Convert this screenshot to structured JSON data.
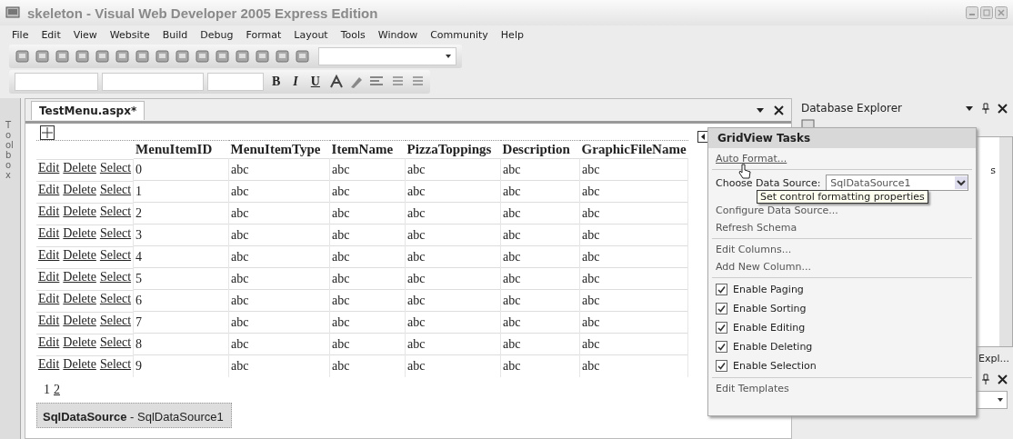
{
  "window": {
    "title": "skeleton - Visual Web Developer 2005 Express Edition"
  },
  "menu": [
    "File",
    "Edit",
    "View",
    "Website",
    "Build",
    "Debug",
    "Format",
    "Layout",
    "Tools",
    "Window",
    "Community",
    "Help"
  ],
  "format_toolbar": {
    "buttons": [
      "B",
      "I",
      "U"
    ]
  },
  "toolbox": {
    "label": "Toolbox"
  },
  "document": {
    "tab": {
      "label": "TestMenu.aspx*",
      "selected": true
    },
    "grid": {
      "columns": [
        "MenuItemID",
        "MenuItemType",
        "ItemName",
        "PizzaToppings",
        "Description",
        "GraphicFileName"
      ],
      "rows": [
        {
          "commands": [
            "Edit",
            "Delete",
            "Select"
          ],
          "cells": [
            "0",
            "abc",
            "abc",
            "abc",
            "abc",
            "abc"
          ]
        },
        {
          "commands": [
            "Edit",
            "Delete",
            "Select"
          ],
          "cells": [
            "1",
            "abc",
            "abc",
            "abc",
            "abc",
            "abc"
          ]
        },
        {
          "commands": [
            "Edit",
            "Delete",
            "Select"
          ],
          "cells": [
            "2",
            "abc",
            "abc",
            "abc",
            "abc",
            "abc"
          ]
        },
        {
          "commands": [
            "Edit",
            "Delete",
            "Select"
          ],
          "cells": [
            "3",
            "abc",
            "abc",
            "abc",
            "abc",
            "abc"
          ]
        },
        {
          "commands": [
            "Edit",
            "Delete",
            "Select"
          ],
          "cells": [
            "4",
            "abc",
            "abc",
            "abc",
            "abc",
            "abc"
          ]
        },
        {
          "commands": [
            "Edit",
            "Delete",
            "Select"
          ],
          "cells": [
            "5",
            "abc",
            "abc",
            "abc",
            "abc",
            "abc"
          ]
        },
        {
          "commands": [
            "Edit",
            "Delete",
            "Select"
          ],
          "cells": [
            "6",
            "abc",
            "abc",
            "abc",
            "abc",
            "abc"
          ]
        },
        {
          "commands": [
            "Edit",
            "Delete",
            "Select"
          ],
          "cells": [
            "7",
            "abc",
            "abc",
            "abc",
            "abc",
            "abc"
          ]
        },
        {
          "commands": [
            "Edit",
            "Delete",
            "Select"
          ],
          "cells": [
            "8",
            "abc",
            "abc",
            "abc",
            "abc",
            "abc"
          ]
        },
        {
          "commands": [
            "Edit",
            "Delete",
            "Select"
          ],
          "cells": [
            "9",
            "abc",
            "abc",
            "abc",
            "abc",
            "abc"
          ]
        }
      ],
      "pager": [
        {
          "label": "1",
          "selected": true
        },
        {
          "label": "2",
          "selected": false
        }
      ]
    },
    "datasource": {
      "type": "SqlDataSource",
      "name": "- SqlDataSource1"
    }
  },
  "side_panel": {
    "title": "Database Explorer",
    "tree_text": "s",
    "tab_label": "Expl..."
  },
  "tasks_popup": {
    "title": "GridView Tasks",
    "tooltip": "Set control formatting properties",
    "groups": [
      [
        {
          "kind": "link",
          "label": "Auto Format..."
        }
      ],
      [
        {
          "kind": "combo",
          "label": "Choose Data Source:",
          "value": "SqlDataSource1"
        },
        {
          "kind": "link",
          "label": "Configure Data Source..."
        },
        {
          "kind": "link",
          "label": "Refresh Schema"
        }
      ],
      [
        {
          "kind": "link",
          "label": "Edit Columns..."
        },
        {
          "kind": "link",
          "label": "Add New Column..."
        }
      ],
      [
        {
          "kind": "checkbox",
          "label": "Enable Paging",
          "checked": true
        },
        {
          "kind": "checkbox",
          "label": "Enable Sorting",
          "checked": true
        },
        {
          "kind": "checkbox",
          "label": "Enable Editing",
          "checked": true
        },
        {
          "kind": "checkbox",
          "label": "Enable Deleting",
          "checked": true
        },
        {
          "kind": "checkbox",
          "label": "Enable Selection",
          "checked": true
        }
      ],
      [
        {
          "kind": "link",
          "label": "Edit Templates"
        }
      ]
    ]
  }
}
